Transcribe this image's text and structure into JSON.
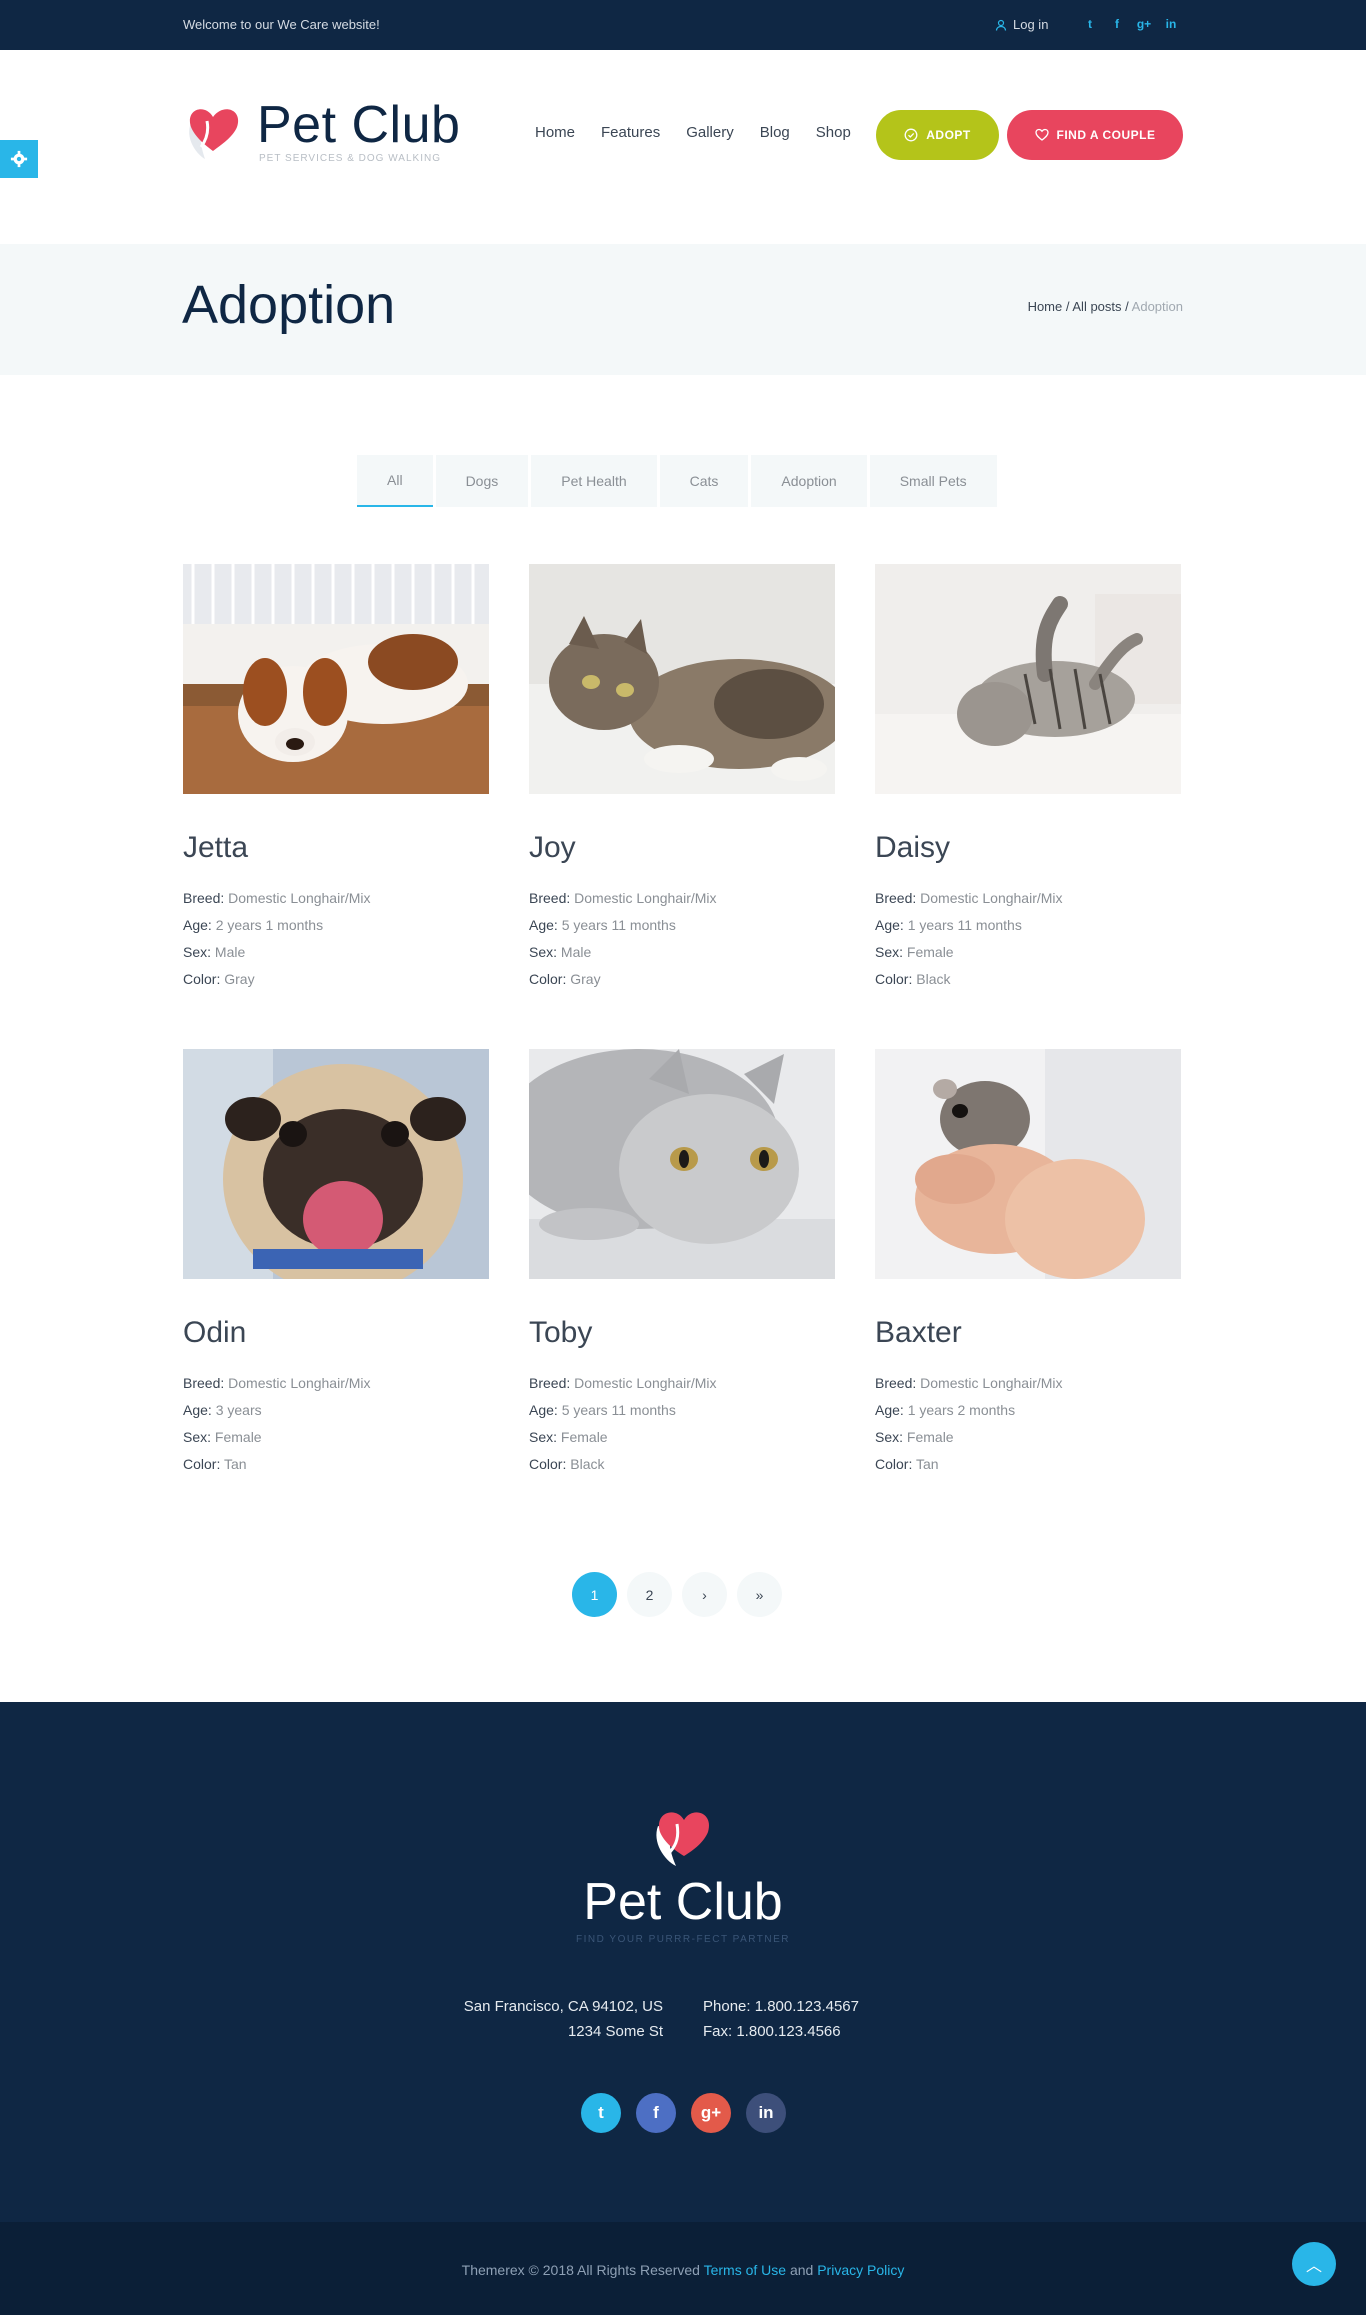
{
  "topbar": {
    "welcome": "Welcome to our We Care website!",
    "login": "Log in",
    "socials": [
      "twitter-icon",
      "facebook-icon",
      "google-plus-icon",
      "linkedin-icon"
    ]
  },
  "header": {
    "logo_name": "Pet Club",
    "logo_tagline": "PET SERVICES & DOG WALKING",
    "nav": [
      "Home",
      "Features",
      "Gallery",
      "Blog",
      "Shop"
    ],
    "adopt_label": "ADOPT",
    "couple_label": "FIND A COUPLE"
  },
  "page": {
    "title": "Adoption",
    "breadcrumb": [
      "Home",
      "All posts",
      "Adoption"
    ]
  },
  "filters": [
    "All",
    "Dogs",
    "Pet Health",
    "Cats",
    "Adoption",
    "Small Pets"
  ],
  "labels": {
    "breed": "Breed:",
    "age": "Age:",
    "sex": "Sex:",
    "color": "Color:"
  },
  "pets": [
    {
      "name": "Jetta",
      "breed": "Domestic Longhair/Mix",
      "age": "2 years 1 months",
      "sex": "Male",
      "color": "Gray"
    },
    {
      "name": "Joy",
      "breed": "Domestic Longhair/Mix",
      "age": "5 years 11 months",
      "sex": "Male",
      "color": "Gray"
    },
    {
      "name": "Daisy",
      "breed": "Domestic Longhair/Mix",
      "age": "1 years 11 months",
      "sex": "Female",
      "color": "Black"
    },
    {
      "name": "Odin",
      "breed": "Domestic Longhair/Mix",
      "age": "3 years",
      "sex": "Female",
      "color": "Tan"
    },
    {
      "name": "Toby",
      "breed": "Domestic Longhair/Mix",
      "age": "5 years 11 months",
      "sex": "Female",
      "color": "Black"
    },
    {
      "name": "Baxter",
      "breed": "Domestic Longhair/Mix",
      "age": "1 years 2 months",
      "sex": "Female",
      "color": "Tan"
    }
  ],
  "pagination": {
    "pages": [
      "1",
      "2"
    ],
    "next": "›",
    "last": "»"
  },
  "footer": {
    "logo_name": "Pet Club",
    "logo_tagline": "FIND YOUR PURRR-FECT PARTNER",
    "address_line1": "San Francisco, CA 94102, US",
    "address_line2": "1234 Some St",
    "phone": "Phone: 1.800.123.4567",
    "fax": "Fax: 1.800.123.4566",
    "copyright_prefix": "Themerex © 2018 All Rights Reserved",
    "terms": "Terms of Use",
    "and": "and",
    "privacy": "Privacy Policy"
  },
  "colors": {
    "navy": "#0f2744",
    "accent_blue": "#29b6e8",
    "adopt_green": "#b4c41a",
    "couple_red": "#e8455e"
  }
}
